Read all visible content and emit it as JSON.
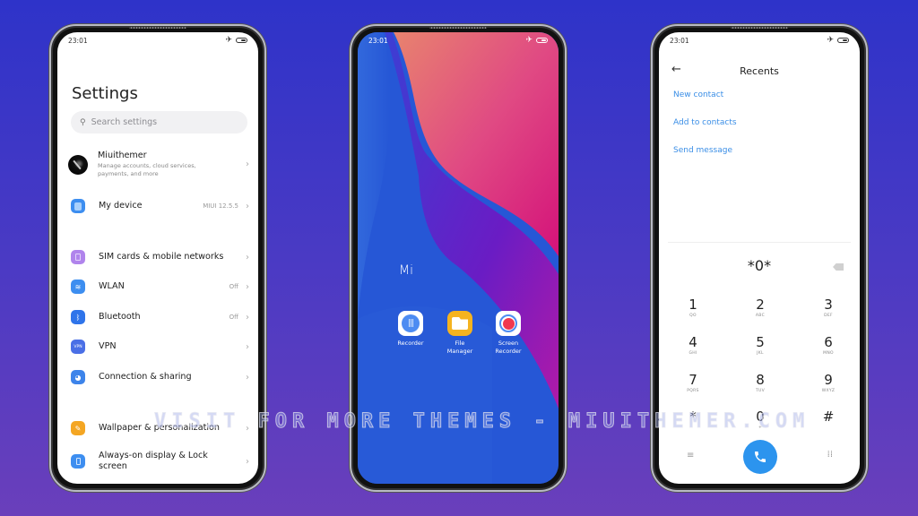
{
  "status_bar": {
    "time": "23:01",
    "airplane_icon": "airplane-icon",
    "battery_icon": "battery-icon"
  },
  "settings": {
    "title": "Settings",
    "search_placeholder": "Search settings",
    "account": {
      "name": "Miuithemer",
      "subtitle": "Manage accounts, cloud services, payments, and more"
    },
    "items": [
      {
        "label": "My device",
        "value": "MIUI 12.5.5",
        "icon": "device-icon",
        "color": "#3d8ef0"
      },
      {
        "label": "SIM cards & mobile networks",
        "value": "",
        "icon": "sim-icon",
        "color": "#b084ec"
      },
      {
        "label": "WLAN",
        "value": "Off",
        "icon": "wifi-icon",
        "color": "#3d8ef0"
      },
      {
        "label": "Bluetooth",
        "value": "Off",
        "icon": "bluetooth-icon",
        "color": "#2f74ea"
      },
      {
        "label": "VPN",
        "value": "",
        "icon": "vpn-icon",
        "color": "#4a6fe6",
        "glyph": "VPN"
      },
      {
        "label": "Connection & sharing",
        "value": "",
        "icon": "globe-icon",
        "color": "#3d84ea"
      },
      {
        "label": "Wallpaper & personalization",
        "value": "",
        "icon": "wallpaper-icon",
        "color": "#f4a623"
      },
      {
        "label": "Always-on display & Lock screen",
        "value": "",
        "icon": "lock-screen-icon",
        "color": "#3d8ef0"
      }
    ]
  },
  "home": {
    "folder_label": "Mi",
    "apps": [
      {
        "label": "Recorder",
        "icon": "recorder-icon"
      },
      {
        "label": "File Manager",
        "icon": "folder-icon"
      },
      {
        "label": "Screen Recorder",
        "icon": "screen-recorder-icon"
      }
    ]
  },
  "dialer": {
    "title": "Recents",
    "back_icon": "back-arrow-icon",
    "actions": [
      "New contact",
      "Add to contacts",
      "Send message"
    ],
    "display": "*0*",
    "keys": [
      {
        "num": "1",
        "letters": "QO"
      },
      {
        "num": "2",
        "letters": "ABC"
      },
      {
        "num": "3",
        "letters": "DEF"
      },
      {
        "num": "4",
        "letters": "GHI"
      },
      {
        "num": "5",
        "letters": "JKL"
      },
      {
        "num": "6",
        "letters": "MNO"
      },
      {
        "num": "7",
        "letters": "PQRS"
      },
      {
        "num": "8",
        "letters": "TUV"
      },
      {
        "num": "9",
        "letters": "WXYZ"
      },
      {
        "num": "*",
        "letters": ""
      },
      {
        "num": "0",
        "letters": "+"
      },
      {
        "num": "#",
        "letters": ""
      }
    ],
    "accent": "#2c94ee"
  },
  "watermark": "VISIT FOR MORE THEMES - MIUITHEMER.COM"
}
